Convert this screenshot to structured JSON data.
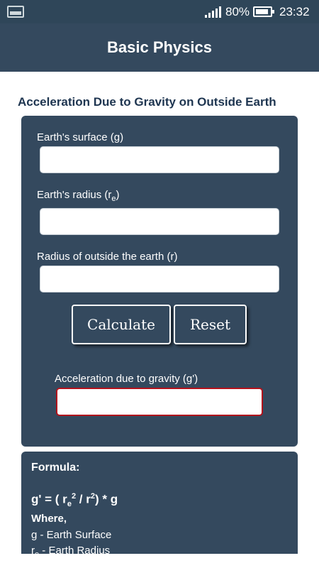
{
  "status_bar": {
    "battery": "80%",
    "time": "23:32"
  },
  "app_bar": {
    "title": "Basic Physics"
  },
  "section_title": "Acceleration Due to Gravity on Outside Earth",
  "form": {
    "surface_label": "Earth's surface (g)",
    "surface_value": "",
    "radius_label_main": "Earth's radius (r",
    "radius_label_sub": "e",
    "radius_label_end": ")",
    "radius_value": "",
    "outside_radius_label": "Radius of outside the earth (r)",
    "outside_radius_value": "",
    "calculate_label": "Calculate",
    "reset_label": "Reset",
    "result_label": "Acceleration due to gravity (g')",
    "result_value": ""
  },
  "formula": {
    "heading": "Formula:",
    "eq_a": "g' = ( r",
    "eq_sub": "e",
    "eq_sup1": "2",
    "eq_b": " / r",
    "eq_sup2": "2",
    "eq_c": ") * g",
    "where": "Where,",
    "line1": "g - Earth Surface",
    "line2_main": "r",
    "line2_sub": "e",
    "line2_rest": " - Earth Radius"
  },
  "colors": {
    "header": "#34495e",
    "status_bar": "#2f4659",
    "result_border": "#b3121c",
    "title_text": "#1e3550"
  }
}
